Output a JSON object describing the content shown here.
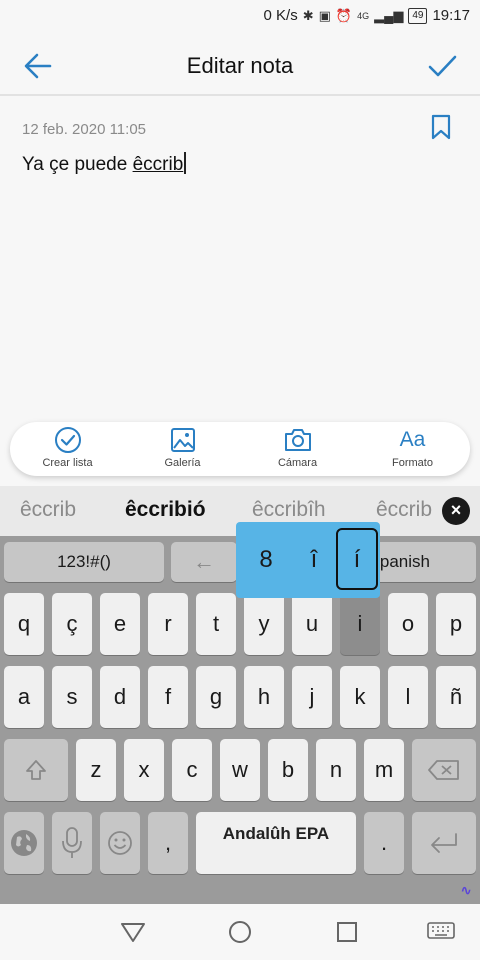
{
  "status": {
    "speed": "0 K/s",
    "network": "4G",
    "battery": "49",
    "time": "19:17"
  },
  "header": {
    "title": "Editar nota"
  },
  "note": {
    "date": "12 feb. 2020 11:05",
    "text_plain": "Ya çe puede ",
    "text_underlined": "êccrib"
  },
  "toolbar": {
    "items": [
      {
        "label": "Crear lista",
        "icon": "check-circle-icon"
      },
      {
        "label": "Galería",
        "icon": "image-icon"
      },
      {
        "label": "Cámara",
        "icon": "camera-icon"
      },
      {
        "label": "Formato",
        "icon": "format-text-icon",
        "glyph": "Aa"
      }
    ]
  },
  "keyboard": {
    "suggestions": [
      "êccrib",
      "êccribió",
      "êccribîh",
      "êccrib"
    ],
    "row0": {
      "symbols": "123!#()",
      "language_space_left": "←",
      "language": "Spanish"
    },
    "row1": [
      "q",
      "ç",
      "e",
      "r",
      "t",
      "y",
      "u",
      "i",
      "o",
      "p"
    ],
    "row2": [
      "a",
      "s",
      "d",
      "f",
      "g",
      "h",
      "j",
      "k",
      "l",
      "ñ"
    ],
    "row3": [
      "z",
      "x",
      "c",
      "w",
      "b",
      "n",
      "m"
    ],
    "space_label": "Andalûh EPA",
    "comma": ",",
    "period": ".",
    "popup": [
      "8",
      "î",
      "í"
    ]
  },
  "colors": {
    "accent": "#2a7fc3",
    "popup": "#57b4e6"
  }
}
